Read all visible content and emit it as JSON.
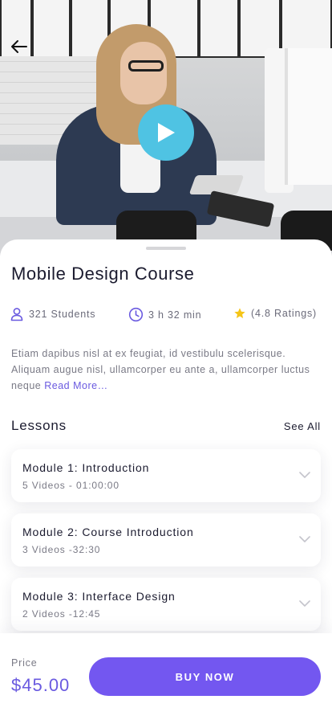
{
  "course": {
    "title": "Mobile Design Course",
    "students": "321 Students",
    "duration": "3 h 32 min",
    "ratings": "(4.8 Ratings)",
    "description": "Etiam dapibus nisl at ex feugiat, id vestibulu scelerisque. Aliquam augue nisl, ullamcorper eu ante a, ullamcorper luctus neque",
    "read_more": "Read More…"
  },
  "lessons": {
    "title": "Lessons",
    "see_all": "See All",
    "modules": [
      {
        "title": "Module 1: Introduction",
        "sub": "5 Videos - 01:00:00"
      },
      {
        "title": "Module 2: Course Introduction",
        "sub": "3 Videos -32:30"
      },
      {
        "title": "Module 3: Interface Design",
        "sub": "2 Videos -12:45"
      }
    ]
  },
  "footer": {
    "price_label": "Price",
    "price": "$45.00",
    "buy_label": "BUY NOW"
  },
  "icons": {
    "back": "arrow-left-icon",
    "play": "play-icon",
    "students": "user-icon",
    "duration": "clock-icon",
    "rating": "star-icon",
    "module_toggle": "chevron-down-icon"
  },
  "colors": {
    "accent": "#7357f0",
    "price": "#6a5ae0",
    "play": "#4fc3e3",
    "star": "#f5c518"
  }
}
